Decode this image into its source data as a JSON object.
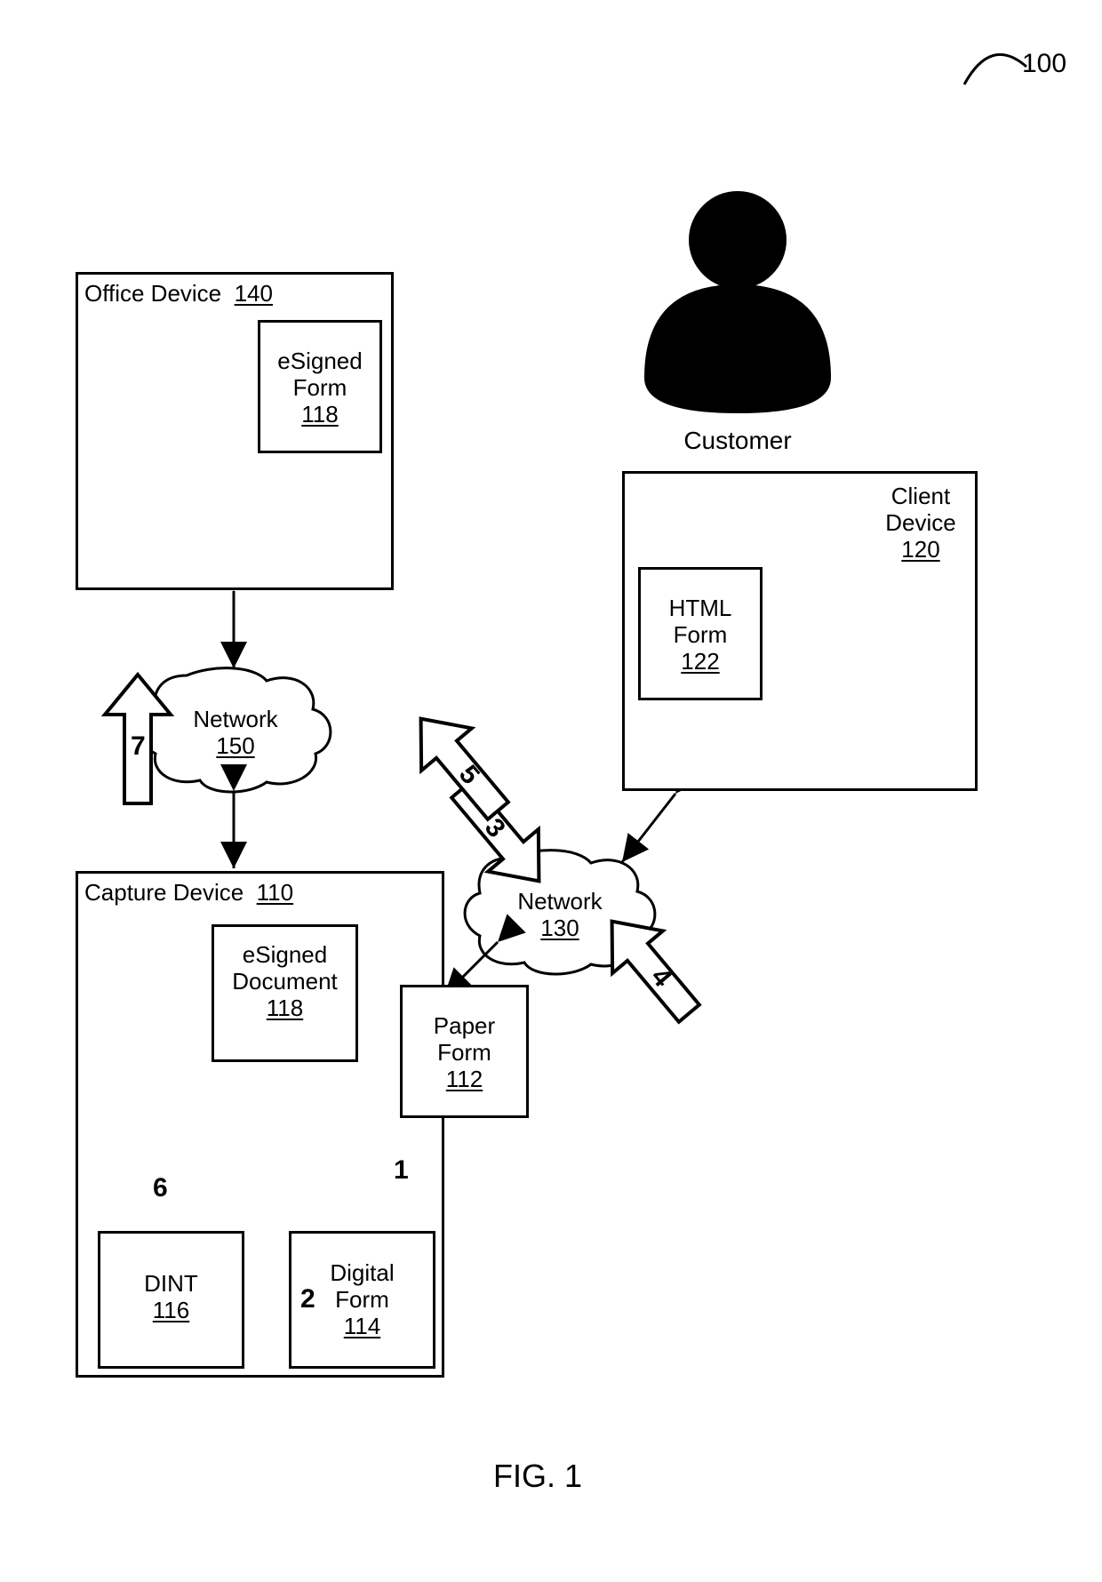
{
  "figure_label": "FIG. 1",
  "system_ref": "100",
  "customer_label": "Customer",
  "office_device": {
    "title": "Office Device",
    "ref": "140"
  },
  "esigned_form_office": {
    "title": "eSigned\nForm",
    "ref": "118"
  },
  "network_a": {
    "title": "Network",
    "ref": "150"
  },
  "network_b": {
    "title": "Network",
    "ref": "130"
  },
  "capture_device": {
    "title": "Capture Device",
    "ref": "110"
  },
  "esigned_doc": {
    "title": "eSigned\nDocument",
    "ref": "118"
  },
  "dint": {
    "title": "DINT",
    "ref": "116"
  },
  "digital_form": {
    "title": "Digital\nForm",
    "ref": "114"
  },
  "paper_form": {
    "title": "Paper\nForm",
    "ref": "112"
  },
  "client_device": {
    "title": "Client\nDevice",
    "ref": "120"
  },
  "html_form": {
    "title": "HTML\nForm",
    "ref": "122"
  },
  "steps": {
    "s1": "1",
    "s2": "2",
    "s3": "3",
    "s4": "4",
    "s5": "5",
    "s6": "6",
    "s7": "7"
  }
}
